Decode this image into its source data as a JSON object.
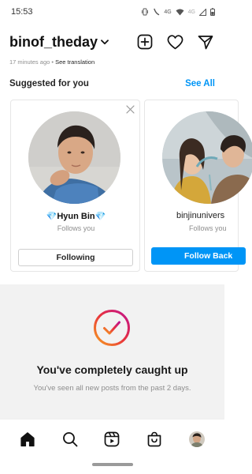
{
  "status_bar": {
    "time": "15:53",
    "network_1": "4G",
    "network_2": "4G"
  },
  "header": {
    "username": "binof_theday",
    "icons": [
      "chevron-down-icon",
      "new-post-icon",
      "heart-icon",
      "direct-message-icon"
    ]
  },
  "post_meta": {
    "time_ago": "17 minutes ago",
    "separator": " • ",
    "translate_label": "See translation"
  },
  "suggested": {
    "title": "Suggested for you",
    "see_all_label": "See All",
    "cards": [
      {
        "name": "💎Hyun Bin💎",
        "subtitle": "Follows you",
        "button_label": "Following"
      },
      {
        "name": "binjinunivers",
        "subtitle": "Follows you",
        "button_label": "Follow Back"
      }
    ]
  },
  "caught_up": {
    "title": "You've completely caught up",
    "subtitle": "You've seen all new posts from the past 2 days."
  },
  "bottom_nav": {
    "items": [
      "home-icon",
      "search-icon",
      "reels-icon",
      "shop-icon",
      "profile-avatar"
    ]
  },
  "colors": {
    "accent_blue": "#0095f6",
    "caught_up_bg": "#f2f2f2",
    "gradient_start": "#f7a11f",
    "gradient_end": "#c1128e"
  }
}
